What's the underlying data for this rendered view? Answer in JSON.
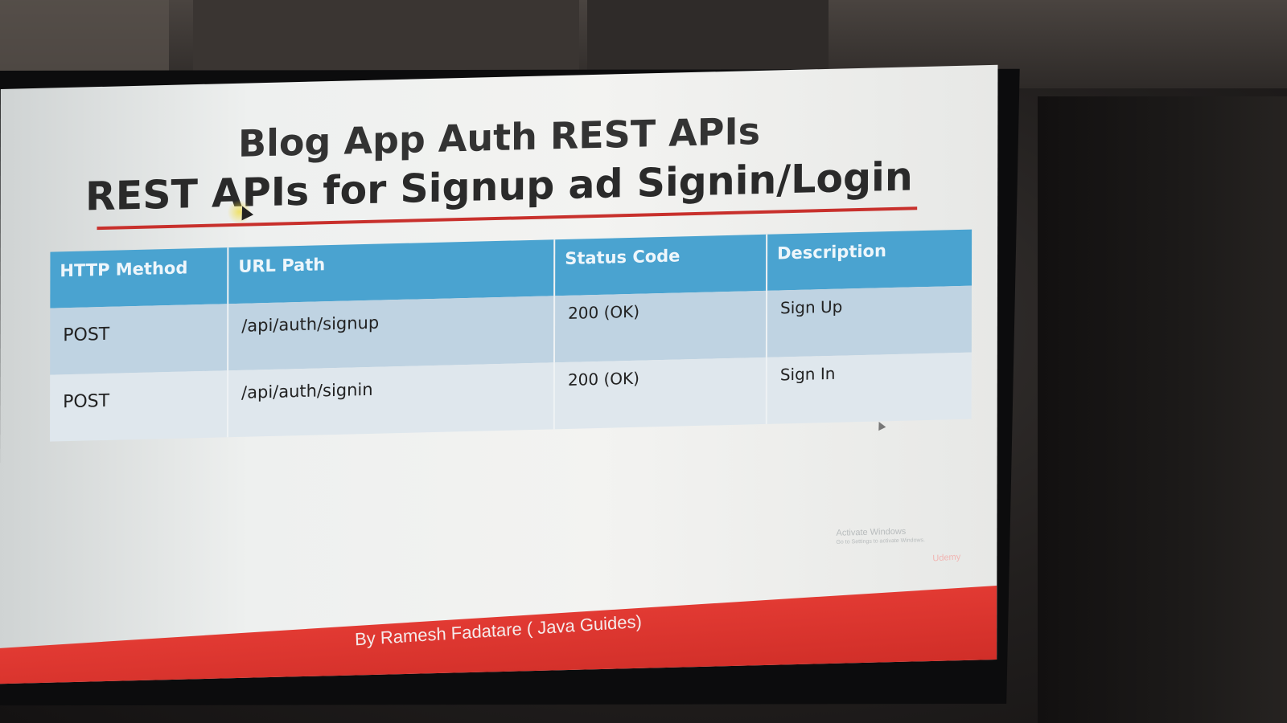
{
  "slide": {
    "title_line1": "Blog App Auth REST APIs",
    "title_line2": "REST APIs for Signup ad Signin/Login",
    "accent_color": "#c8302c",
    "header_color": "#4aa3d0"
  },
  "table": {
    "headers": [
      "HTTP Method",
      "URL Path",
      "Status Code",
      "Description"
    ],
    "rows": [
      {
        "method": "POST",
        "path": "/api/auth/signup",
        "status": "200 (OK)",
        "description": "Sign Up"
      },
      {
        "method": "POST",
        "path": "/api/auth/signin",
        "status": "200 (OK)",
        "description": "Sign In"
      }
    ]
  },
  "watermark": {
    "line1": "Activate Windows",
    "line2": "Go to Settings to activate Windows."
  },
  "footer": {
    "byline": "By Ramesh Fadatare ( Java Guides)",
    "brand": "Udemy",
    "color": "#e23a33"
  }
}
